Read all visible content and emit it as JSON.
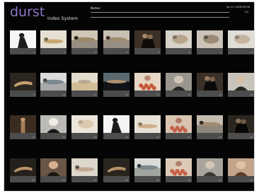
{
  "header": {
    "brand": "durst",
    "subtitle": "Index System",
    "notes_label": "Notes:",
    "date_stamp": "Jan 23, 2006 09:58",
    "counter": "1/4"
  },
  "sheet": {
    "rows": [
      [
        {
          "shot": "portrait-white",
          "fill": "#f6f6f6",
          "dark": "#1d1d1d",
          "accent": "#5a4a3a",
          "num": "1"
        },
        {
          "shot": "light-figure",
          "fill": "#e6e0d4",
          "dark": "#7a6a52",
          "accent": "#c9a86e",
          "num": "2"
        },
        {
          "shot": "reclining-figure",
          "fill": "#cfc6b6",
          "dark": "#2a2520",
          "accent": "#9c8868",
          "num": "3"
        },
        {
          "shot": "reclining-figure",
          "fill": "#c8c0b2",
          "dark": "#3a3028",
          "accent": "#a08c70",
          "num": "4"
        },
        {
          "shot": "couple-dark",
          "fill": "#3c3026",
          "dark": "#0e0b08",
          "accent": "#a88668",
          "num": "5"
        },
        {
          "shot": "figure-soft",
          "fill": "#d8d2c8",
          "dark": "#5a4e42",
          "accent": "#b8a48c",
          "num": "6"
        },
        {
          "shot": "figure-soft",
          "fill": "#ccc4b8",
          "dark": "#3a332a",
          "accent": "#9c8a74",
          "num": "7"
        },
        {
          "shot": "close-up",
          "fill": "#e0dcd6",
          "dark": "#6a625a",
          "accent": "#c4b4a0",
          "num": "8"
        }
      ],
      [
        {
          "shot": "hand-dark",
          "fill": "#2c2620",
          "dark": "#0c0a08",
          "accent": "#c8a070",
          "num": "9"
        },
        {
          "shot": "reclining-white",
          "fill": "#dcdcdc",
          "dark": "#4a4a4a",
          "accent": "#7a8890",
          "num": "10"
        },
        {
          "shot": "bath-scene",
          "fill": "#e4dccc",
          "dark": "#8a7a62",
          "accent": "#d2bc98",
          "num": "11"
        },
        {
          "shot": "reclining-dark",
          "fill": "#5a6a70",
          "dark": "#101418",
          "accent": "#b09070",
          "num": "12"
        },
        {
          "shot": "roses-portrait",
          "fill": "#e8d6c4",
          "dark": "#8a4a30",
          "accent": "#c45a3a",
          "num": "13"
        },
        {
          "shot": "grey-portrait",
          "fill": "#9a968e",
          "dark": "#2a2622",
          "accent": "#d0c4b4",
          "num": "14"
        },
        {
          "shot": "dark-figure",
          "fill": "#3a3028",
          "dark": "#0c0a08",
          "accent": "#9a7a60",
          "num": "15"
        },
        {
          "shot": "face-portrait",
          "fill": "#c8c4bc",
          "dark": "#2a2622",
          "accent": "#d4c0a8",
          "num": "16"
        }
      ],
      [
        {
          "shot": "standing-dark",
          "fill": "#3a2c20",
          "dark": "#0a0806",
          "accent": "#c89a6a",
          "num": "17"
        },
        {
          "shot": "bw-portrait",
          "fill": "#bcbab6",
          "dark": "#1a1816",
          "accent": "#f0ece6",
          "num": "18"
        },
        {
          "shot": "light-scene",
          "fill": "#ece6da",
          "dark": "#a09480",
          "accent": "#dccab0",
          "num": "19"
        },
        {
          "shot": "standing-white",
          "fill": "#f4f4f2",
          "dark": "#1c1a18",
          "accent": "#6a5a4c",
          "num": "20"
        },
        {
          "shot": "reclining-light",
          "fill": "#e8e2d6",
          "dark": "#8a7860",
          "accent": "#d0b08a",
          "num": "21"
        },
        {
          "shot": "roses-scene",
          "fill": "#d8c4b0",
          "dark": "#8a3a28",
          "accent": "#c4624a",
          "num": "22"
        },
        {
          "shot": "reclining-figure",
          "fill": "#c4bcae",
          "dark": "#2c2620",
          "accent": "#a08a70",
          "num": "23"
        },
        {
          "shot": "dark-figure",
          "fill": "#2c2620",
          "dark": "#080706",
          "accent": "#8a7058",
          "num": "24"
        }
      ],
      [
        {
          "shot": "hand-dark",
          "fill": "#24201c",
          "dark": "#080706",
          "accent": "#b89068",
          "num": "25"
        },
        {
          "shot": "warm-portrait",
          "fill": "#6a5444",
          "dark": "#1a140e",
          "accent": "#d4b090",
          "num": "26"
        },
        {
          "shot": "reclining-light",
          "fill": "#ddd6ca",
          "dark": "#5a5046",
          "accent": "#c0a890",
          "num": "27"
        },
        {
          "shot": "hand-dark",
          "fill": "#2a241e",
          "dark": "#0a0806",
          "accent": "#b49068",
          "num": "28"
        },
        {
          "shot": "reclining-white",
          "fill": "#dadcd8",
          "dark": "#3a3c38",
          "accent": "#7c8a8e",
          "num": "29"
        },
        {
          "shot": "roses-scene",
          "fill": "#dccab8",
          "dark": "#8c4230",
          "accent": "#c86048",
          "num": "30"
        },
        {
          "shot": "grey-portrait",
          "fill": "#a8a49c",
          "dark": "#3a3630",
          "accent": "#d2c6b6",
          "num": "31"
        },
        {
          "shot": "warm-portrait",
          "fill": "#c4a48a",
          "dark": "#5a3e2a",
          "accent": "#e0c4a8",
          "num": "32"
        }
      ]
    ]
  }
}
